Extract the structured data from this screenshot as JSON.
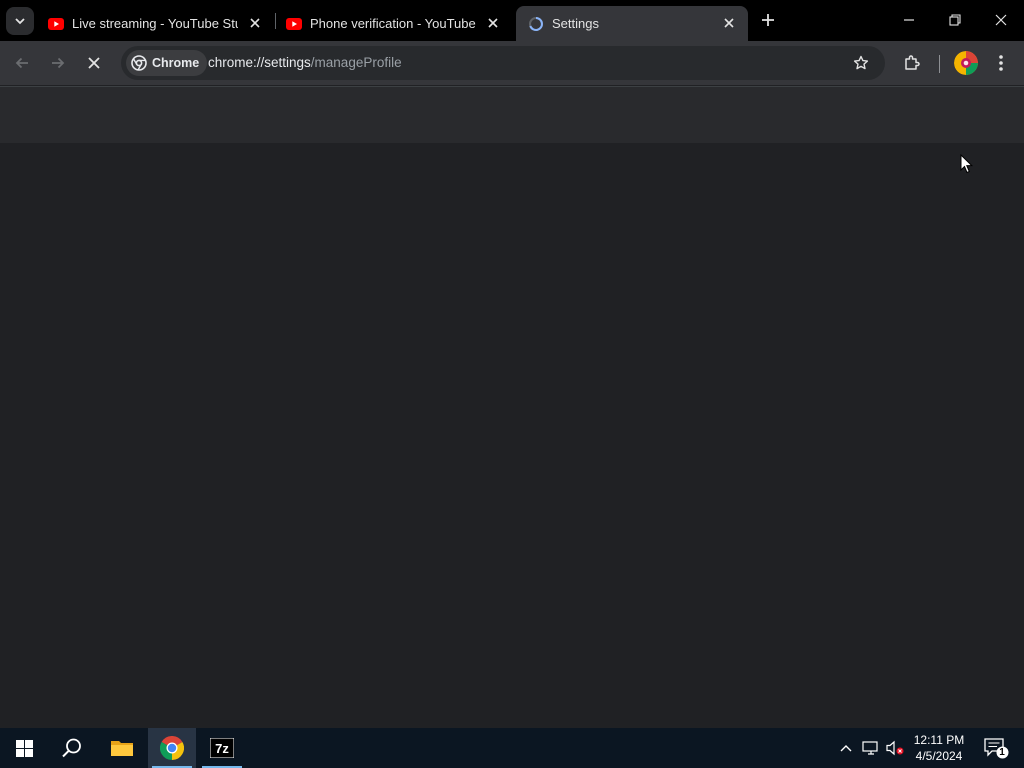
{
  "browser": {
    "tabs": [
      {
        "title": "Live streaming - YouTube Studio",
        "favicon": "youtube-icon"
      },
      {
        "title": "Phone verification - YouTube",
        "favicon": "youtube-icon"
      },
      {
        "title": "Settings",
        "favicon": "chrome-settings-icon",
        "active": true
      }
    ],
    "chip_label": "Chrome",
    "url_host": "chrome://settings",
    "url_path": "/manageProfile",
    "loading": true
  },
  "taskbar": {
    "apps": [
      "windows-start-icon",
      "search-icon",
      "file-explorer-icon",
      "chrome-icon",
      "7zip-icon"
    ],
    "active_app": "chrome-icon",
    "time": "12:11 PM",
    "date": "4/5/2024",
    "notification_count": "1"
  },
  "colors": {
    "tabstrip": "#000000",
    "toolbar": "#35363a",
    "page": "#202124",
    "taskbar": "#0b1622",
    "youtube_red": "#ff0000",
    "accent": "#8ab4f8"
  }
}
